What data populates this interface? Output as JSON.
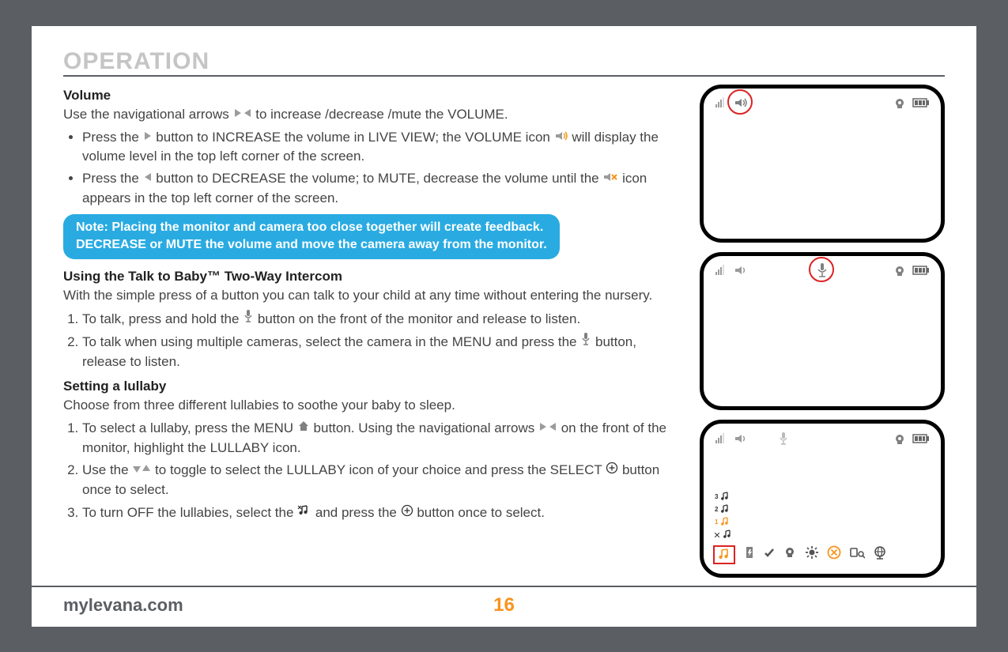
{
  "section_title": "OPERATION",
  "volume": {
    "heading": "Volume",
    "intro_1": "Use the navigational arrows ",
    "intro_2": " to increase /decrease /mute the VOLUME.",
    "bullets": {
      "b1a": "Press the ",
      "b1b": " button to INCREASE the volume in LIVE VIEW; the VOLUME icon ",
      "b1c": " will display the volume level in the top left corner of the screen.",
      "b2a": "Press the ",
      "b2b": " button to DECREASE the volume; to MUTE, decrease the volume until the ",
      "b2c": " icon appears in the top left corner of the screen."
    }
  },
  "note_line1": "Note: Placing the monitor and camera too close together will create feedback.",
  "note_line2": "DECREASE or MUTE the volume and move the camera away from the monitor.",
  "intercom": {
    "heading": "Using the Talk to Baby™ Two-Way Intercom",
    "intro": "With the simple press of a button you can talk to your child at any time without entering the nursery.",
    "s1a": "To talk, press and hold the ",
    "s1b": " button on the front of the monitor and release to listen.",
    "s2a": "To talk when using multiple cameras, select the camera in the MENU and press the ",
    "s2b": " button, release to listen."
  },
  "lullaby": {
    "heading": "Setting a lullaby",
    "intro": "Choose from three different lullabies to soothe your baby to sleep.",
    "s1a": "To select a lullaby, press the MENU ",
    "s1b": " button.  Using the  navigational arrows ",
    "s1c": " on the front of the monitor, highlight the LULLABY icon.",
    "s2a": "Use the ",
    "s2b": " to toggle to select the LULLABY icon of your choice and press the SELECT ",
    "s2c": " button once to select.",
    "s3a": "To turn OFF the lullabies, select the ",
    "s3b": "  and press the ",
    "s3c": " button once to select."
  },
  "lullaby_numbers": {
    "n3": "3",
    "n2": "2",
    "n1": "1"
  },
  "footer": {
    "url": "mylevana.com",
    "page": "16"
  }
}
